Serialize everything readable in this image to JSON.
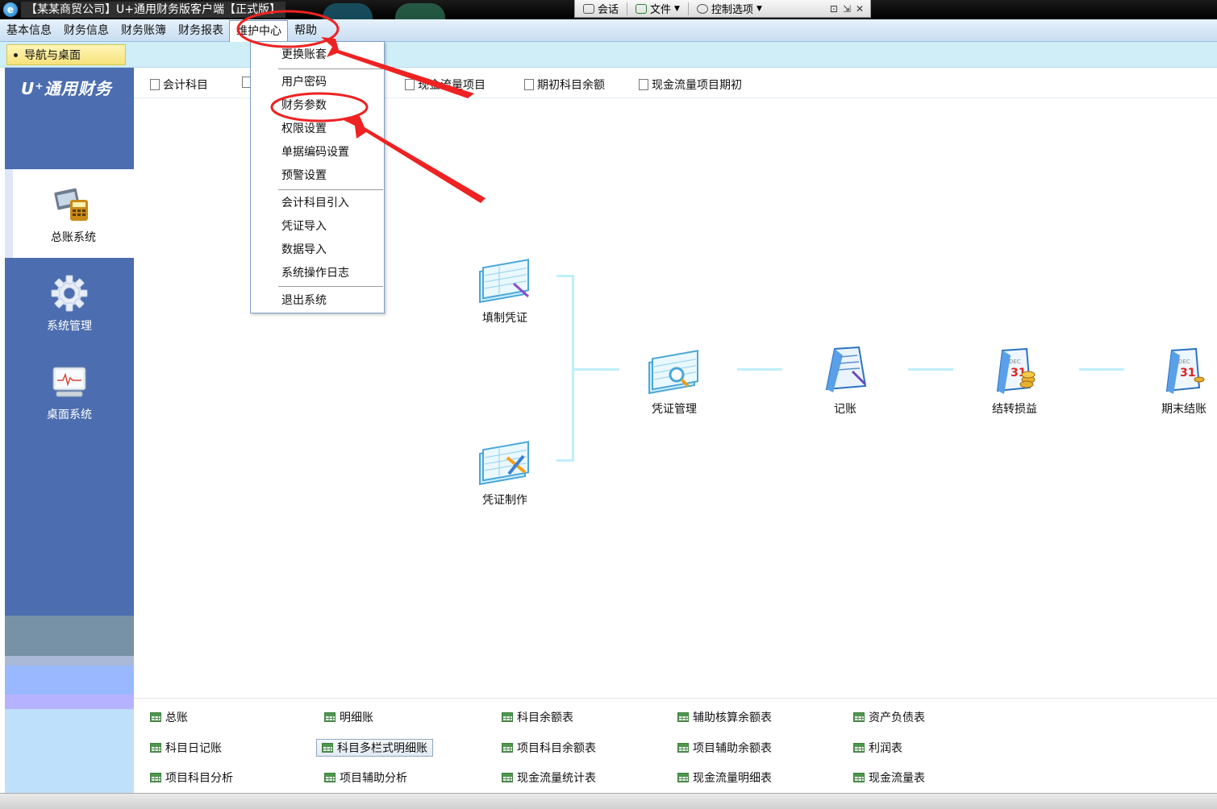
{
  "window": {
    "title": "【某某商贸公司】U+通用财务版客户端【正式版】",
    "app_icon_glyph": "e"
  },
  "remote_toolbar": {
    "items": [
      {
        "label": "会话",
        "icon": "chat-icon"
      },
      {
        "label": "文件",
        "icon": "file-transfer-icon"
      },
      {
        "label": "控制选项",
        "icon": "wrench-icon"
      }
    ],
    "small_icons": [
      "⊡",
      "⇲",
      "✕"
    ]
  },
  "menubar": {
    "items": [
      "基本信息",
      "财务信息",
      "财务账簿",
      "财务报表",
      "维护中心",
      "帮助"
    ],
    "active": "维护中心"
  },
  "tabs": {
    "nav_tab": "导航与桌面"
  },
  "sidebar": {
    "logo": "U⁺通用财务",
    "items": [
      {
        "label": "总账系统",
        "icon": "ledger-calculator-icon",
        "selected": true
      },
      {
        "label": "系统管理",
        "icon": "gear-icon",
        "selected": false
      },
      {
        "label": "桌面系统",
        "icon": "monitor-icon",
        "selected": false
      }
    ]
  },
  "shortcuts": [
    "会计科目",
    "",
    "现金流量项目",
    "期初科目余额",
    "现金流量项目期初"
  ],
  "dropdown": {
    "group1": [
      "更换账套"
    ],
    "group2": [
      "用户密码",
      "财务参数",
      "权限设置",
      "单据编码设置",
      "预警设置"
    ],
    "group3": [
      "会计科目引入",
      "凭证导入",
      "数据导入",
      "系统操作日志"
    ],
    "group4": [
      "退出系统"
    ]
  },
  "flow": {
    "nodes": [
      "填制凭证",
      "凭证制作",
      "凭证管理",
      "记账",
      "结转损益",
      "期末结账"
    ],
    "calendar_text": "31",
    "calendar_month": "DEC"
  },
  "reports": {
    "col1": [
      "总账",
      "科目日记账",
      "项目科目分析"
    ],
    "col2": [
      "明细账",
      "科目多栏式明细账",
      "项目辅助分析"
    ],
    "col3": [
      "科目余额表",
      "项目科目余额表",
      "现金流量统计表"
    ],
    "col4": [
      "辅助核算余额表",
      "项目辅助余额表",
      "现金流量明细表"
    ],
    "col5": [
      "资产负债表",
      "利润表",
      "现金流量表"
    ],
    "highlighted": "科目多栏式明细账"
  },
  "colors": {
    "sidebar": "#4c6eb0",
    "annotation_red": "#ee2222",
    "menubar": "#d6e7f7",
    "tabstrip": "#cfeef8"
  }
}
